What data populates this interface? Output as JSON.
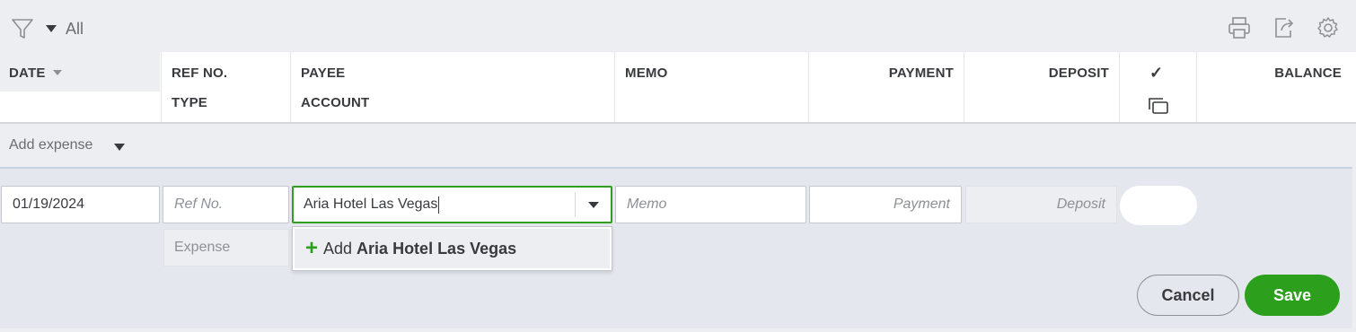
{
  "toolbar": {
    "filter_caret": "▾",
    "filter_value": "All",
    "icons": [
      "print-icon",
      "export-icon",
      "settings-gear-icon"
    ]
  },
  "columns": {
    "date": "DATE",
    "ref_no": "REF NO.",
    "type": "TYPE",
    "payee": "PAYEE",
    "account": "ACCOUNT",
    "memo": "MEMO",
    "payment": "PAYMENT",
    "deposit": "DEPOSIT",
    "check": "✓",
    "balance": "BALANCE"
  },
  "add_expense": {
    "label": "Add expense"
  },
  "entry": {
    "date_value": "01/19/2024",
    "ref_placeholder": "Ref No.",
    "payee_value": "Aria Hotel Las Vegas",
    "memo_placeholder": "Memo",
    "payment_placeholder": "Payment",
    "deposit_placeholder": "Deposit",
    "type_value": "Expense"
  },
  "suggestion": {
    "prefix": "Add",
    "name": "Aria Hotel Las Vegas"
  },
  "actions": {
    "cancel_label": "Cancel",
    "save_label": "Save"
  },
  "colors": {
    "accent_green": "#2ca01c",
    "page_bg": "#eceef1",
    "edit_row_bg": "#e4e8ee"
  }
}
